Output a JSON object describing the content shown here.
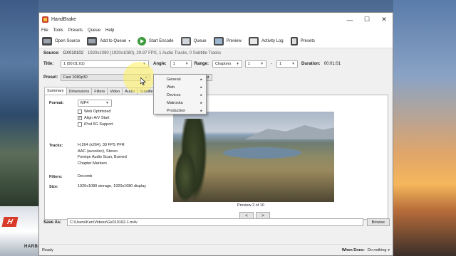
{
  "window": {
    "title": "HandBrake",
    "controls": {
      "minimize": "—",
      "maximize": "☐",
      "close": "✕"
    }
  },
  "menubar": [
    "File",
    "Tools",
    "Presets",
    "Queue",
    "Help"
  ],
  "toolbar": {
    "open_source": "Open Source",
    "add_to_queue": "Add to Queue",
    "add_to_queue_arrow": "▾",
    "start_encode": "Start Encode",
    "queue": "Queue",
    "preview": "Preview",
    "activity_log": "Activity Log",
    "presets": "Presets"
  },
  "source": {
    "label": "Source:",
    "name": "GX010102",
    "info": "1920x1080 (1920x1080), 29.97 FPS, 1 Audio Tracks, 0 Subtitle Tracks"
  },
  "title_row": {
    "title_label": "Title:",
    "title_value": "1 (00:01:01)",
    "angle_label": "Angle:",
    "angle_value": "1",
    "range_label": "Range:",
    "range_value": "Chapters",
    "range_start": "1",
    "range_sep": "-",
    "range_end": "1",
    "duration_label": "Duration:",
    "duration_value": "00:01:01"
  },
  "preset": {
    "label": "Preset:",
    "value": "Fast 1080p30",
    "reset_label": "et"
  },
  "tabs": [
    "Summary",
    "Dimensions",
    "Filters",
    "Video",
    "Audio",
    "Subtitle"
  ],
  "summary": {
    "format_label": "Format:",
    "format_value": "MP4",
    "web_optimized": "Web Optimized",
    "align_av": "Align A/V Start",
    "ipod": "iPod 5G Support",
    "tracks_label": "Tracks:",
    "tracks": [
      "H.264 (x264), 30 FPS PFR",
      "AAC (avcodec), Stereo",
      "Foreign Audio Scan, Burned",
      "Chapter Markers"
    ],
    "filters_label": "Filters:",
    "filters_value": "Decomb",
    "size_label": "Size:",
    "size_value": "1920x1080 storage, 1920x1080 display"
  },
  "preview": {
    "caption": "Preview 2 of 10",
    "prev": "<",
    "next": ">"
  },
  "preset_menu": [
    "General",
    "Web",
    "Devices",
    "Matroska",
    "Production"
  ],
  "save": {
    "label": "Save As:",
    "path": "C:\\Users\\Ken\\Videos\\Gx010102-1.m4v",
    "browse": "Browse"
  },
  "status": {
    "text": "Ready",
    "when_done_label": "When Done:",
    "when_done_value": "Do nothing"
  },
  "desktop": {
    "logo_text": "H",
    "caption": "HARBOUR AIR"
  },
  "colors": {
    "start_green": "#3c9a3a",
    "menu_bg": "#f5f5f5",
    "highlight": "#fff05a"
  }
}
